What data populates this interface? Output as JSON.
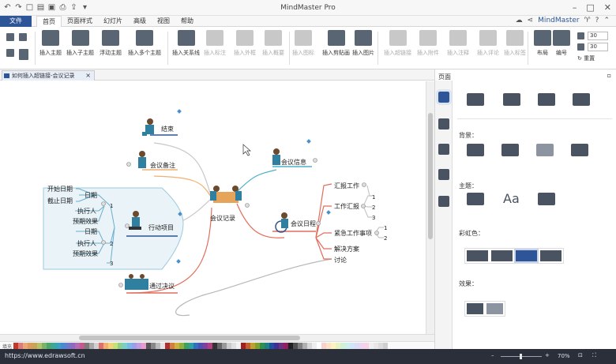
{
  "app": {
    "title": "MindMaster Pro",
    "user": "MindMaster",
    "url": "https://www.edrawsoft.cn",
    "zoom": "70%"
  },
  "menu": {
    "file": "文件",
    "items": [
      "首页",
      "页面样式",
      "幻灯片",
      "高级",
      "视图",
      "帮助"
    ],
    "active": 0
  },
  "ribbon": {
    "buttons": [
      "插入主题",
      "插入子主题",
      "浮动主题",
      "插入多个主题",
      "插入关系线",
      "插入标注",
      "插入外框",
      "插入概要",
      "插入图标",
      "插入剪贴画",
      "插入图片",
      "插入超链接",
      "插入附件",
      "插入注释",
      "插入评论",
      "插入标签",
      "布局",
      "编号"
    ],
    "spin1": "30",
    "spin2": "30",
    "reset": "重置"
  },
  "doc": {
    "tab": "如何插入超链接-会议记录"
  },
  "panel": {
    "title": "页面",
    "background": "背景：",
    "theme": "主题：",
    "rainbow": "彩虹色：",
    "effects": "效果：",
    "theme_font": "Aa"
  },
  "palette": {
    "label": "填充"
  },
  "mindmap": {
    "center": "会议记录",
    "topics": {
      "end": "结束",
      "notes": "会议备注",
      "actions": "行动项目",
      "resolution": "通过决议",
      "info": "会议信息",
      "agenda": "会议日程",
      "agenda_items": [
        "汇报工作",
        "工作汇报",
        "紧急工作事项",
        "解决方案",
        "讨论"
      ],
      "agenda_nums": [
        "1",
        "2",
        "3",
        "1",
        "2"
      ],
      "action_nums": [
        "1",
        "2",
        "3"
      ],
      "action_item1": [
        "日期",
        "执行人",
        "预期效果"
      ],
      "action_item2": [
        "日期",
        "执行人",
        "预期效果"
      ],
      "date_sub": [
        "开始日期",
        "截止日期"
      ]
    }
  }
}
